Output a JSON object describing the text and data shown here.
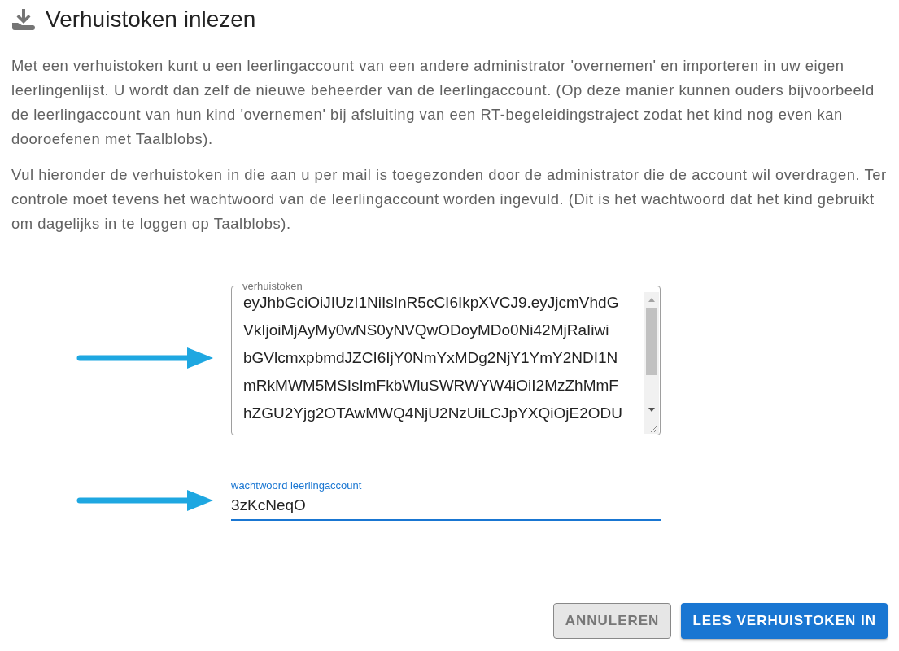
{
  "dialog": {
    "title": "Verhuistoken inlezen",
    "paragraphs": [
      "Met een verhuistoken kunt u een leerlingaccount van een andere administrator 'overnemen' en importeren in uw eigen leerlingenlijst. U wordt dan zelf de nieuwe beheerder van de leerlingaccount. (Op deze manier kunnen ouders bijvoorbeeld de leerlingaccount van hun kind 'overnemen' bij afsluiting van een RT-begeleidingstraject zodat het kind nog even kan dooroefenen met Taalblobs).",
      "Vul hieronder de verhuistoken in die aan u per mail is toegezonden door de administrator die de account wil overdragen. Ter controle moet tevens het wachtwoord van de leerlingaccount worden ingevuld. (Dit is het wachtwoord dat het kind gebruikt om dagelijks in te loggen op Taalblobs)."
    ],
    "token_field": {
      "label": "verhuistoken",
      "value_lines": [
        "eyJhbGciOiJIUzI1NiIsInR5cCI6IkpXVCJ9.eyJjcmVhdG",
        "VkIjoiMjAyMy0wNS0yNVQwODoyMDo0Ni42MjRaIiwi",
        "bGVlcmxpbmdJZCI6IjY0NmYxMDg2NjY1YmY2NDI1N",
        "mRkMWM5MSIsImFkbWluSWRWYW4iOiI2MzZhMmF",
        "hZGU2Yjg2OTAwMWQ4NjU2NzUiLCJpYXQiOjE2ODU"
      ]
    },
    "password_field": {
      "label": "wachtwoord leerlingaccount",
      "value": "3zKcNeqO",
      "focused": true
    },
    "buttons": [
      {
        "label": "ANNULEREN",
        "kind": "secondary"
      },
      {
        "label": "LEES VERHUISTOKEN IN",
        "kind": "primary"
      }
    ]
  }
}
